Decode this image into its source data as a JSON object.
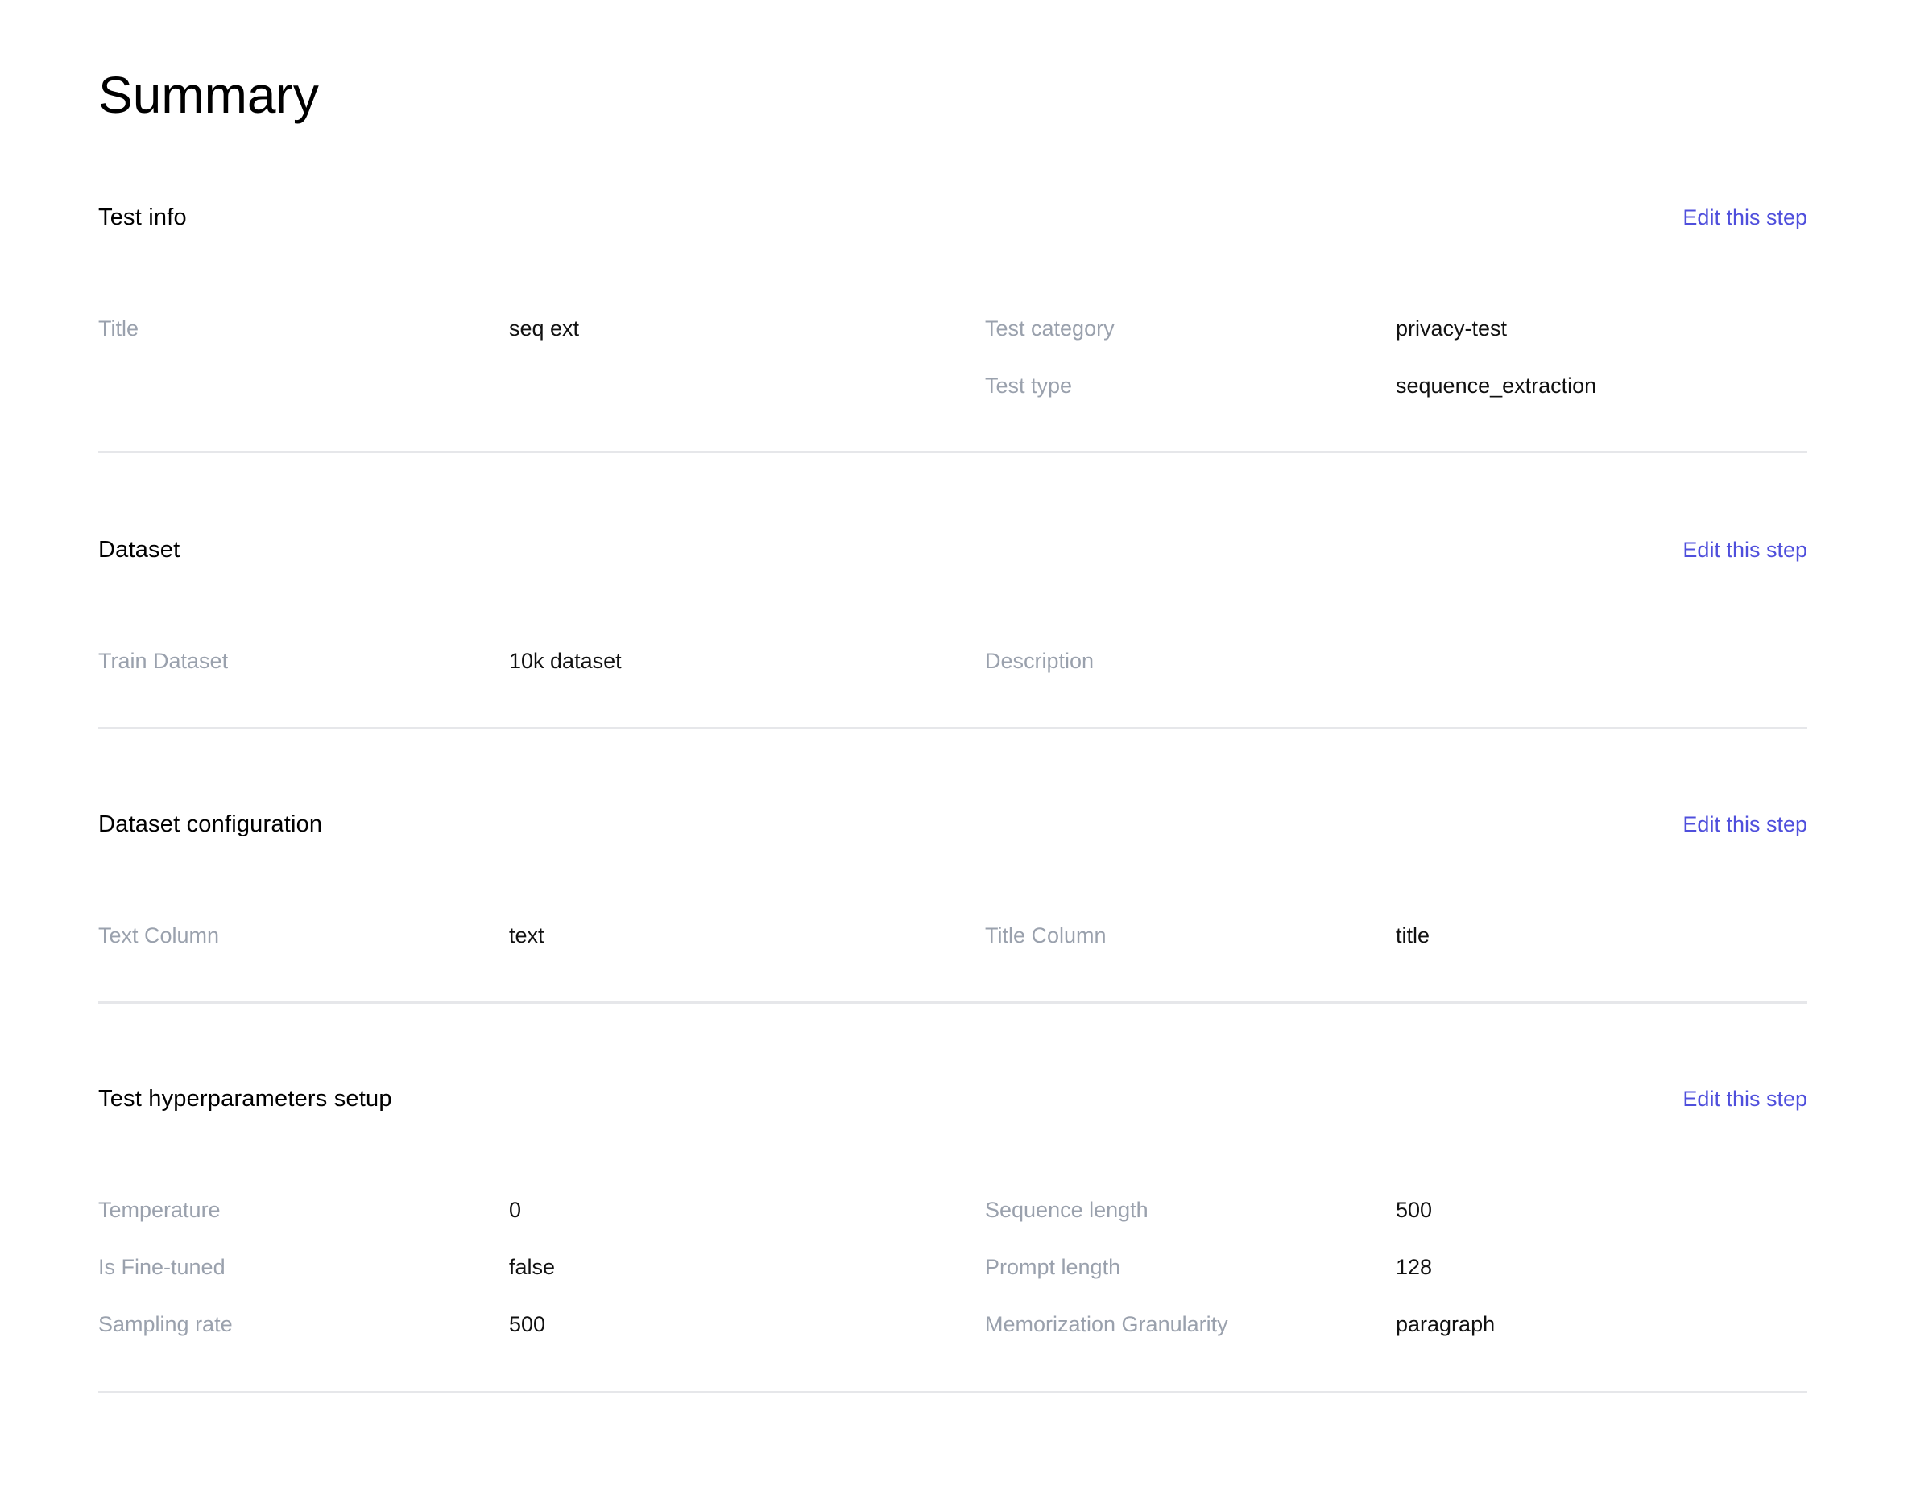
{
  "page": {
    "title": "Summary"
  },
  "sections": [
    {
      "title": "Test info",
      "edit_label": "Edit this step",
      "rows": [
        {
          "l1": "Title",
          "v1": "seq ext",
          "l2": "Test category",
          "v2": "privacy-test"
        },
        {
          "l1": "",
          "v1": "",
          "l2": "Test type",
          "v2": "sequence_extraction"
        }
      ]
    },
    {
      "title": "Dataset",
      "edit_label": "Edit this step",
      "rows": [
        {
          "l1": "Train Dataset",
          "v1": "10k dataset",
          "l2": "Description",
          "v2": ""
        }
      ]
    },
    {
      "title": "Dataset configuration",
      "edit_label": "Edit this step",
      "rows": [
        {
          "l1": "Text Column",
          "v1": "text",
          "l2": "Title Column",
          "v2": "title"
        }
      ]
    },
    {
      "title": "Test hyperparameters setup",
      "edit_label": "Edit this step",
      "rows": [
        {
          "l1": "Temperature",
          "v1": "0",
          "l2": "Sequence length",
          "v2": "500"
        },
        {
          "l1": "Is Fine-tuned",
          "v1": "false",
          "l2": "Prompt length",
          "v2": "128"
        },
        {
          "l1": "Sampling rate",
          "v1": "500",
          "l2": "Memorization Granularity",
          "v2": "paragraph"
        }
      ]
    }
  ],
  "colors": {
    "accent_link": "#4f4fdc",
    "label_text": "#9aa1ad",
    "divider": "#e6e7ea"
  }
}
